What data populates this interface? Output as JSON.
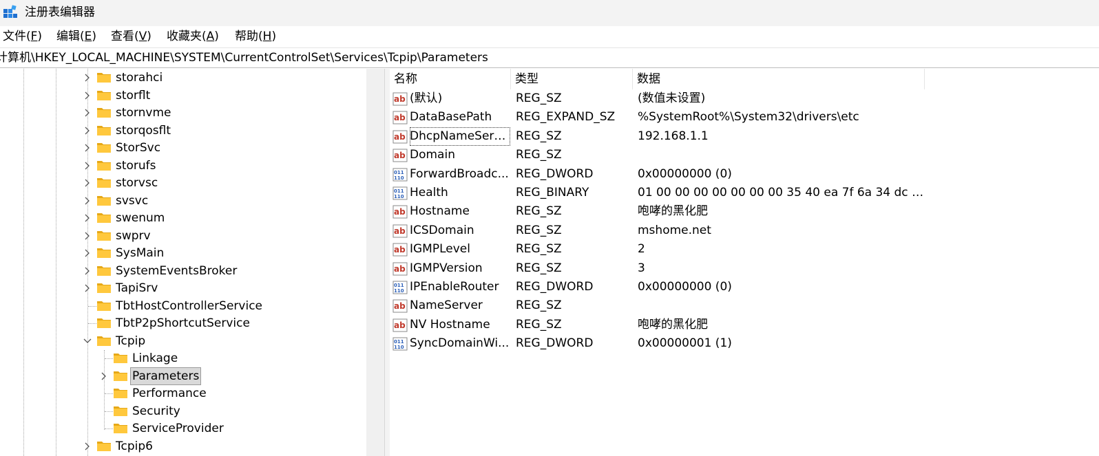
{
  "window": {
    "title": "注册表编辑器"
  },
  "menu": [
    {
      "text": "文件(",
      "key": "F",
      "end": ")"
    },
    {
      "text": "编辑(",
      "key": "E",
      "end": ")"
    },
    {
      "text": "查看(",
      "key": "V",
      "end": ")"
    },
    {
      "text": "收藏夹(",
      "key": "A",
      "end": ")"
    },
    {
      "text": "帮助(",
      "key": "H",
      "end": ")"
    }
  ],
  "address": "计算机\\HKEY_LOCAL_MACHINE\\SYSTEM\\CurrentControlSet\\Services\\Tcpip\\Parameters",
  "tree": [
    {
      "label": "storahci",
      "level": 0,
      "expander": "collapsed"
    },
    {
      "label": "storflt",
      "level": 0,
      "expander": "collapsed"
    },
    {
      "label": "stornvme",
      "level": 0,
      "expander": "collapsed"
    },
    {
      "label": "storqosflt",
      "level": 0,
      "expander": "collapsed"
    },
    {
      "label": "StorSvc",
      "level": 0,
      "expander": "collapsed"
    },
    {
      "label": "storufs",
      "level": 0,
      "expander": "collapsed"
    },
    {
      "label": "storvsc",
      "level": 0,
      "expander": "collapsed"
    },
    {
      "label": "svsvc",
      "level": 0,
      "expander": "collapsed"
    },
    {
      "label": "swenum",
      "level": 0,
      "expander": "collapsed"
    },
    {
      "label": "swprv",
      "level": 0,
      "expander": "collapsed"
    },
    {
      "label": "SysMain",
      "level": 0,
      "expander": "collapsed"
    },
    {
      "label": "SystemEventsBroker",
      "level": 0,
      "expander": "collapsed"
    },
    {
      "label": "TapiSrv",
      "level": 0,
      "expander": "collapsed"
    },
    {
      "label": "TbtHostControllerService",
      "level": 0,
      "expander": "none"
    },
    {
      "label": "TbtP2pShortcutService",
      "level": 0,
      "expander": "none"
    },
    {
      "label": "Tcpip",
      "level": 0,
      "expander": "expanded"
    },
    {
      "label": "Linkage",
      "level": 1,
      "expander": "none"
    },
    {
      "label": "Parameters",
      "level": 1,
      "expander": "collapsed",
      "selected": true
    },
    {
      "label": "Performance",
      "level": 1,
      "expander": "none"
    },
    {
      "label": "Security",
      "level": 1,
      "expander": "none"
    },
    {
      "label": "ServiceProvider",
      "level": 1,
      "expander": "none"
    },
    {
      "label": "Tcpip6",
      "level": 0,
      "expander": "collapsed"
    }
  ],
  "columns": {
    "name": "名称",
    "type": "类型",
    "data": "数据"
  },
  "values": [
    {
      "icon": "string",
      "name": "(默认)",
      "type": "REG_SZ",
      "data": "(数值未设置)"
    },
    {
      "icon": "string",
      "name": "DataBasePath",
      "type": "REG_EXPAND_SZ",
      "data": "%SystemRoot%\\System32\\drivers\\etc"
    },
    {
      "icon": "string",
      "name": "DhcpNameServ...",
      "type": "REG_SZ",
      "data": "192.168.1.1",
      "focused": true
    },
    {
      "icon": "string",
      "name": "Domain",
      "type": "REG_SZ",
      "data": ""
    },
    {
      "icon": "binary",
      "name": "ForwardBroadc...",
      "type": "REG_DWORD",
      "data": "0x00000000 (0)"
    },
    {
      "icon": "binary",
      "name": "Health",
      "type": "REG_BINARY",
      "data": "01 00 00 00 00 00 00 00 35 40 ea 7f 6a 34 dc 0..."
    },
    {
      "icon": "string",
      "name": "Hostname",
      "type": "REG_SZ",
      "data": "咆哮的黑化肥"
    },
    {
      "icon": "string",
      "name": "ICSDomain",
      "type": "REG_SZ",
      "data": "mshome.net"
    },
    {
      "icon": "string",
      "name": "IGMPLevel",
      "type": "REG_SZ",
      "data": "2"
    },
    {
      "icon": "string",
      "name": "IGMPVersion",
      "type": "REG_SZ",
      "data": "3"
    },
    {
      "icon": "binary",
      "name": "IPEnableRouter",
      "type": "REG_DWORD",
      "data": "0x00000000 (0)"
    },
    {
      "icon": "string",
      "name": "NameServer",
      "type": "REG_SZ",
      "data": ""
    },
    {
      "icon": "string",
      "name": "NV Hostname",
      "type": "REG_SZ",
      "data": "咆哮的黑化肥"
    },
    {
      "icon": "binary",
      "name": "SyncDomainWi...",
      "type": "REG_DWORD",
      "data": "0x00000001 (1)"
    }
  ]
}
